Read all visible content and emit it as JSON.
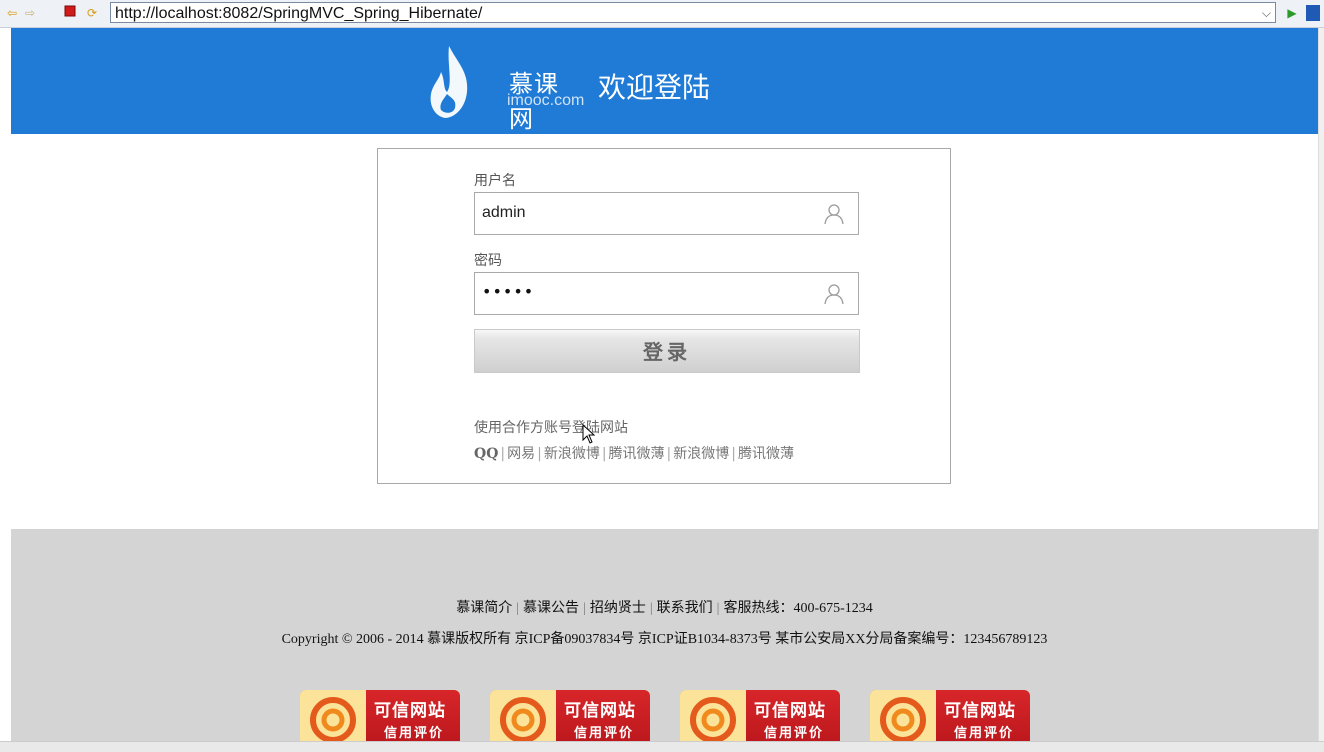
{
  "browser": {
    "url": "http://localhost:8082/SpringMVC_Spring_Hibernate/",
    "icons": [
      "back-arrow-icon",
      "forward-arrow-icon",
      "stop-icon",
      "refresh-icon",
      "go-icon"
    ]
  },
  "header": {
    "logo_cn": "慕课网",
    "logo_en": "imooc.com",
    "title": "欢迎登陆",
    "bg_color": "#1f7bd6"
  },
  "login": {
    "username_label": "用户名",
    "username_value": "admin",
    "password_label": "密码",
    "password_value": "•••••",
    "submit_label": "登录",
    "third_party_text": "使用合作方账号登陆网站",
    "third_party_links": [
      "QQ",
      "网易",
      "新浪微博",
      "腾讯微薄",
      "新浪微博",
      "腾讯微薄"
    ]
  },
  "footer": {
    "links": [
      "慕课简介",
      "慕课公告",
      "招纳贤士",
      "联系我们",
      "客服热线：400-675-1234"
    ],
    "copyright": "Copyright © 2006 - 2014 慕课版权所有   京ICP备09037834号   京ICP证B1034-8373号   某市公安局XX分局备案编号：123456789123",
    "badge_title": "可信网站",
    "badge_sub": "信用评价",
    "badge_count": 4,
    "bg_color": "#d4d4d4"
  }
}
